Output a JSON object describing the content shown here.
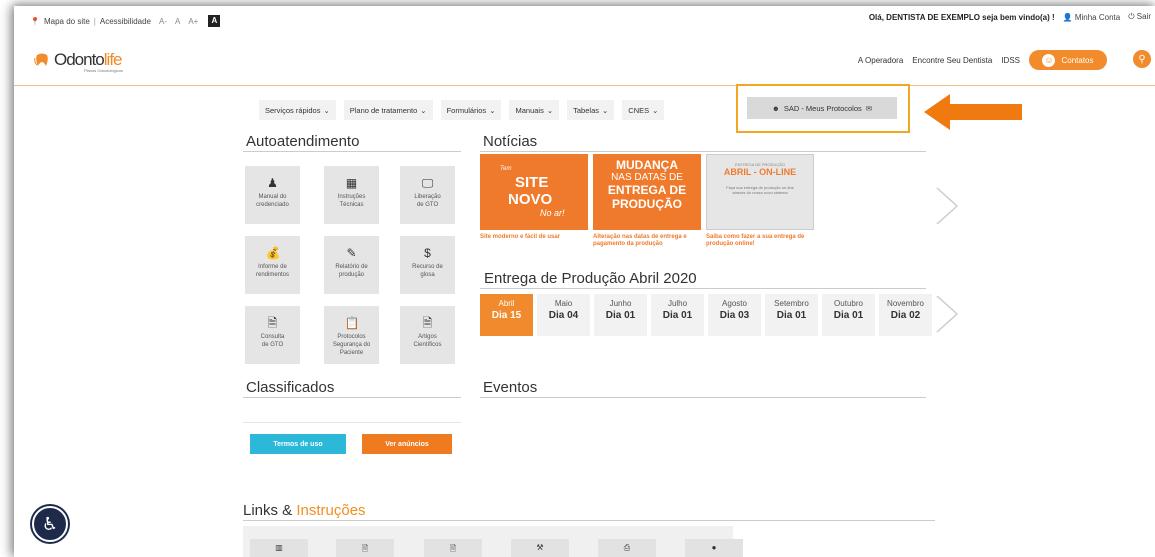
{
  "util": {
    "site_map": "Mapa do site",
    "accessibility": "Acessibilidade",
    "font_minus": "A-",
    "font_normal": "A",
    "font_plus": "A+",
    "contrast": "A",
    "greeting": "Olá, DENTISTA DE EXEMPLO seja bem vindo(a) !",
    "my_account": "Minha Conta",
    "logout": "Sair"
  },
  "header": {
    "logo_text_a": "Odonto",
    "logo_text_b": "life",
    "logo_sub": "Planos Odontológicos",
    "nav": [
      "A Operadora",
      "Encontre Seu Dentista",
      "IDSS"
    ],
    "contatos": "Contatos"
  },
  "submenu": {
    "items": [
      "Serviços rápidos",
      "Plano de tratamento",
      "Formulários",
      "Manuais",
      "Tabelas",
      "CNES"
    ],
    "sad_label": "SAD - Meus Protocolos"
  },
  "autoatendimento": {
    "title": "Autoatendimento",
    "tiles": [
      {
        "l1": "Manual do",
        "l2": "credenciado",
        "l3": ""
      },
      {
        "l1": "Instruções",
        "l2": "Técnicas",
        "l3": ""
      },
      {
        "l1": "Liberação",
        "l2": "de GTO",
        "l3": ""
      },
      {
        "l1": "Informe de",
        "l2": "rendimentos",
        "l3": ""
      },
      {
        "l1": "Relatório de",
        "l2": "produção",
        "l3": ""
      },
      {
        "l1": "Recurso de",
        "l2": "glosa",
        "l3": ""
      },
      {
        "l1": "Consulta",
        "l2": "de GTO",
        "l3": ""
      },
      {
        "l1": "Protocolos",
        "l2": "Segurança do",
        "l3": "Paciente"
      },
      {
        "l1": "Artigos",
        "l2": "Científicos",
        "l3": ""
      }
    ]
  },
  "noticias": {
    "title": "Notícias",
    "n1_a": "Tem",
    "n1_b": "SITE",
    "n1_c": "NOVO",
    "n1_d": "No ar!",
    "n2_a": "MUDANÇA",
    "n2_b": "NAS DATAS DE",
    "n2_c": "ENTREGA DE",
    "n2_d": "PRODUÇÃO",
    "n3_a": "ENTREGA DE PRODUÇÃO",
    "n3_b": "ABRIL - ON-LINE",
    "n3_c": "Faça sua entrega de produção on-line",
    "n3_d": "através do nosso novo sistema",
    "cap1": "Site moderno e fácil de usar",
    "cap2": "Alteração nas datas de entrega e pagamento da produção",
    "cap3": "Saiba como fazer a sua entrega de produção online!"
  },
  "entrega": {
    "title": "Entrega de Produção Abril 2020",
    "dates": [
      {
        "m": "Abril",
        "d": "Dia 15"
      },
      {
        "m": "Maio",
        "d": "Dia 04"
      },
      {
        "m": "Junho",
        "d": "Dia 01"
      },
      {
        "m": "Julho",
        "d": "Dia 01"
      },
      {
        "m": "Agosto",
        "d": "Dia 03"
      },
      {
        "m": "Setembro",
        "d": "Dia 01"
      },
      {
        "m": "Outubro",
        "d": "Dia 01"
      },
      {
        "m": "Novembro",
        "d": "Dia 02"
      }
    ]
  },
  "classificados": {
    "title": "Classificados",
    "termos": "Termos de uso",
    "ver": "Ver anúncios"
  },
  "eventos": {
    "title": "Eventos"
  },
  "links": {
    "title_a": "Links & ",
    "title_b": "Instruções"
  },
  "colors": {
    "accent": "#f28b2b",
    "cyan": "#2bb8d9",
    "highlight": "#f2a623"
  }
}
